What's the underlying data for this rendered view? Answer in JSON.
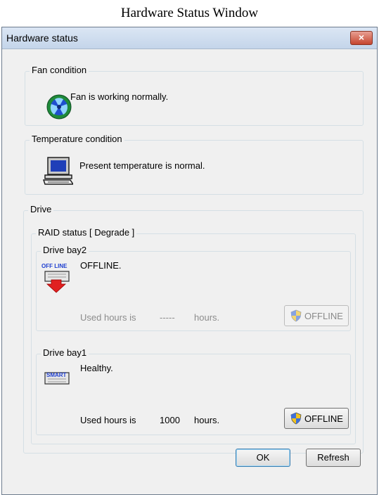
{
  "caption": "Hardware Status Window",
  "window": {
    "title": "Hardware status",
    "close_glyph": "×"
  },
  "fan": {
    "label": "Fan condition",
    "message": "Fan is working normally.",
    "icon": "fan-icon"
  },
  "temperature": {
    "label": "Temperature condition",
    "message": "Present temperature is normal.",
    "icon": "computer-icon"
  },
  "drive": {
    "label": "Drive",
    "raid": {
      "label": "RAID status [ Degrade ]"
    },
    "bays": [
      {
        "label": "Drive bay2",
        "status": "OFFLINE.",
        "icon_text": "OFF LINE",
        "hours_prefix": "Used hours is",
        "hours_value": "-----",
        "hours_suffix": "hours.",
        "button": "OFFLINE",
        "button_enabled": false
      },
      {
        "label": "Drive bay1",
        "status": "Healthy.",
        "icon_text": "SMART",
        "hours_prefix": "Used hours is",
        "hours_value": "1000",
        "hours_suffix": "hours.",
        "button": "OFFLINE",
        "button_enabled": true
      }
    ]
  },
  "buttons": {
    "ok": "OK",
    "refresh": "Refresh"
  },
  "colors": {
    "fan_green": "#1f8a3a",
    "fan_blue": "#1f4fd0",
    "offline_red": "#e02020",
    "shield_blue": "#3f6fd8",
    "shield_yellow": "#f2c41d"
  }
}
